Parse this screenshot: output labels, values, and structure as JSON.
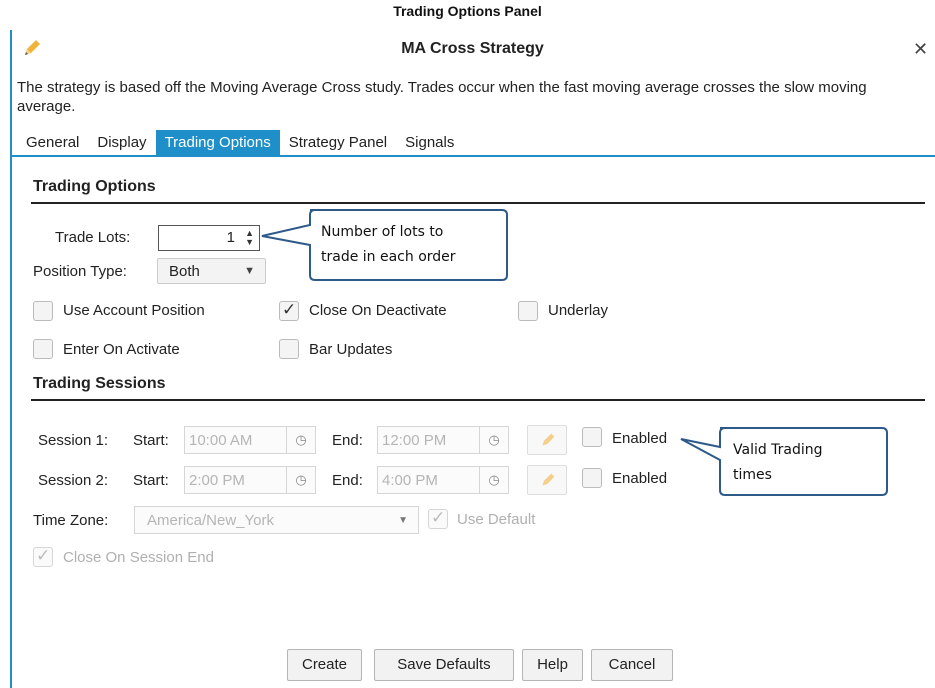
{
  "caption": "Trading Options Panel",
  "window": {
    "title": "MA Cross Strategy",
    "close_symbol": "✕"
  },
  "description": "The strategy is based off the Moving Average Cross study.  Trades occur when the fast moving average crosses the slow moving average.",
  "tabs": [
    {
      "label": "General",
      "active": false
    },
    {
      "label": "Display",
      "active": false
    },
    {
      "label": "Trading Options",
      "active": true
    },
    {
      "label": "Strategy Panel",
      "active": false
    },
    {
      "label": "Signals",
      "active": false
    }
  ],
  "trading_options": {
    "heading": "Trading Options",
    "trade_lots_label": "Trade Lots:",
    "trade_lots_value": "1",
    "position_type_label": "Position Type:",
    "position_type_value": "Both",
    "checkboxes": {
      "use_account_position": {
        "label": "Use Account Position",
        "checked": false
      },
      "close_on_deactivate": {
        "label": "Close On Deactivate",
        "checked": true
      },
      "underlay": {
        "label": "Underlay",
        "checked": false
      },
      "enter_on_activate": {
        "label": "Enter On Activate",
        "checked": false
      },
      "bar_updates": {
        "label": "Bar Updates",
        "checked": false
      }
    }
  },
  "trading_sessions": {
    "heading": "Trading Sessions",
    "sessions": [
      {
        "label": "Session 1:",
        "start_label": "Start:",
        "start": "10:00 AM",
        "end_label": "End:",
        "end": "12:00 PM",
        "enabled_label": "Enabled",
        "enabled": false
      },
      {
        "label": "Session 2:",
        "start_label": "Start:",
        "start": "2:00 PM",
        "end_label": "End:",
        "end": "4:00 PM",
        "enabled_label": "Enabled",
        "enabled": false
      }
    ],
    "time_zone_label": "Time Zone:",
    "time_zone_value": "America/New_York",
    "use_default_label": "Use Default",
    "use_default_checked": true,
    "close_on_session_end_label": "Close On Session End",
    "close_on_session_end_checked": true
  },
  "callouts": {
    "lots_line1": "Number of lots to",
    "lots_line2": "trade in each order",
    "times_line1": "Valid Trading",
    "times_line2": "times"
  },
  "buttons": {
    "create": "Create",
    "save_defaults": "Save Defaults",
    "help": "Help",
    "cancel": "Cancel"
  },
  "colors": {
    "accent": "#1e8fc8",
    "edit_icon": "#f0b43c",
    "callout_border": "#2e5a8a"
  },
  "icons": {
    "window_icon": "pencil-icon",
    "time_button": "clock-icon",
    "session_edit": "pencil-icon",
    "dropdown": "chevron-down-icon"
  }
}
